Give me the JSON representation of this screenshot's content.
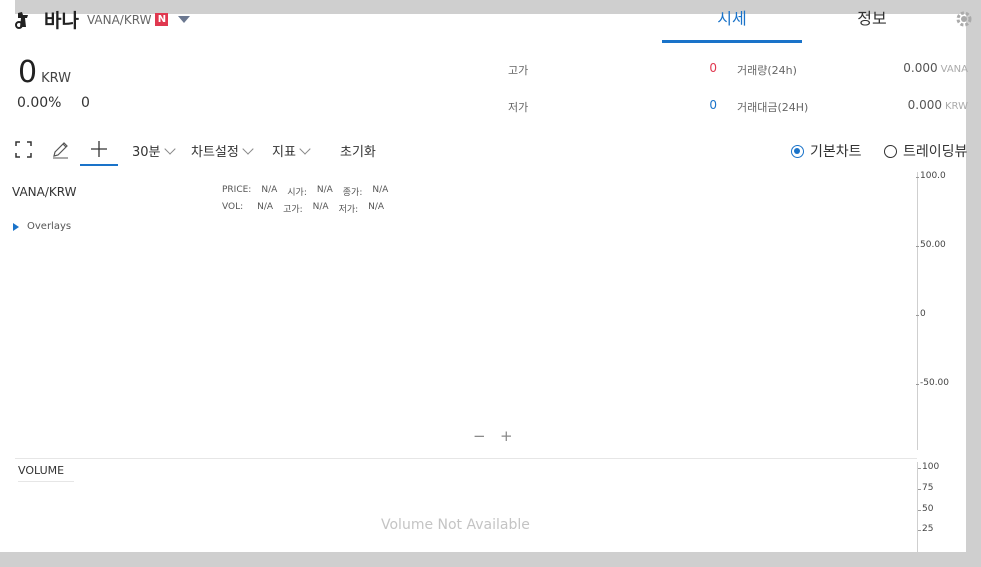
{
  "header": {
    "coin_name": "바나",
    "pair": "VANA/KRW",
    "new_badge": "N",
    "tabs": [
      {
        "label": "시세",
        "active": true
      },
      {
        "label": "정보",
        "active": false
      }
    ]
  },
  "price": {
    "value": "0",
    "currency": "KRW",
    "change_pct": "0.00%",
    "change_val": "0"
  },
  "stats": {
    "high_label": "고가",
    "high_value": "0",
    "low_label": "저가",
    "low_value": "0",
    "volume24_label": "거래량(24h)",
    "volume24_value": "0.000",
    "volume24_unit": "VANA",
    "amount24_label": "거래대금(24H)",
    "amount24_value": "0.000",
    "amount24_unit": "KRW"
  },
  "toolbar": {
    "interval": "30분",
    "chart_settings": "차트설정",
    "indicators": "지표",
    "reset": "초기화",
    "view_options": [
      "기본차트",
      "트레이딩뷰"
    ],
    "selected_view": "기본차트"
  },
  "chart": {
    "symbol": "VANA/KRW",
    "legend": {
      "price_label": "PRICE:",
      "vol_label": "VOL:",
      "open_label": "시가:",
      "close_label": "종가:",
      "high_label": "고가:",
      "low_label": "저가:",
      "na": "N/A"
    },
    "overlays": "Overlays",
    "price_axis": [
      "100.0",
      "50.00",
      "0",
      "-50.00"
    ],
    "zoom_out": "−",
    "zoom_in": "+",
    "volume_title": "VOLUME",
    "volume_axis": [
      "100",
      "75",
      "50",
      "25"
    ],
    "volume_empty": "Volume Not Available"
  },
  "colors": {
    "accent": "#1a73c9",
    "up": "#e0384f",
    "down": "#1a73c9",
    "badge": "#e0384f"
  }
}
